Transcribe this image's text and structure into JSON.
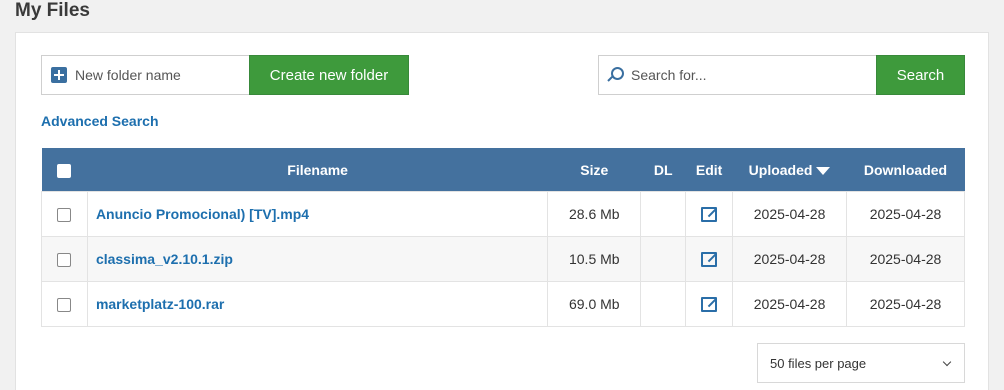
{
  "page": {
    "title": "My Files"
  },
  "folder": {
    "placeholder": "New folder name",
    "icon": "add-folder-icon",
    "create_label": "Create new folder"
  },
  "search": {
    "placeholder": "Search for...",
    "icon": "search-icon",
    "button_label": "Search"
  },
  "advanced_search_label": "Advanced Search",
  "table": {
    "headers": {
      "filename": "Filename",
      "size": "Size",
      "dl": "DL",
      "edit": "Edit",
      "uploaded": "Uploaded",
      "downloaded": "Downloaded"
    },
    "rows": [
      {
        "name": "Anuncio Promocional) [TV].mp4",
        "size": "28.6 Mb",
        "dl": "",
        "uploaded": "2025-04-28",
        "downloaded": "2025-04-28"
      },
      {
        "name": "classima_v2.10.1.zip",
        "size": "10.5 Mb",
        "dl": "",
        "uploaded": "2025-04-28",
        "downloaded": "2025-04-28"
      },
      {
        "name": "marketplatz-100.rar",
        "size": "69.0 Mb",
        "dl": "",
        "uploaded": "2025-04-28",
        "downloaded": "2025-04-28"
      }
    ]
  },
  "per_page": {
    "selected": "50 files per page"
  },
  "colors": {
    "header_bg": "#44719e",
    "button_green": "#3e9a3c",
    "link_blue": "#1d6fae"
  }
}
